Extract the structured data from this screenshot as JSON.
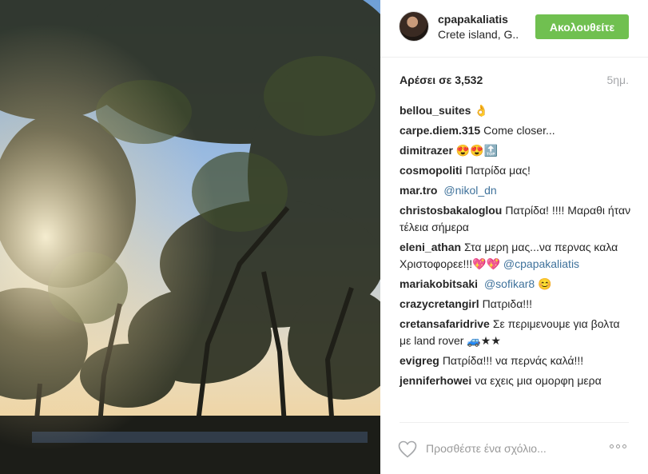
{
  "post": {
    "username": "cpapakaliatis",
    "location": "Crete island, G..",
    "follow_label": "Ακολουθείτε",
    "likes_text": "Αρέσει σε 3,532",
    "time_ago": "5ημ.",
    "comment_placeholder": "Προσθέστε ένα σχόλιο...",
    "colors": {
      "follow_button": "#70c050",
      "mention": "#3f729b"
    },
    "comments": [
      {
        "author": "bellou_suites",
        "text": "👌",
        "mention": ""
      },
      {
        "author": "carpe.diem.315",
        "text": "Come closer...",
        "mention": ""
      },
      {
        "author": "dimitrazer",
        "text": "😍😍🔝",
        "mention": ""
      },
      {
        "author": "cosmopoliti",
        "text": "Πατρίδα μας!",
        "mention": ""
      },
      {
        "author": "mar.tro",
        "text": "",
        "mention": "@nikol_dn"
      },
      {
        "author": "christosbakaloglou",
        "text": "Πατρίδα! !!!! Μαραθι ήταν τέλεια σήμερα",
        "mention": ""
      },
      {
        "author": "eleni_athan",
        "text": "Στα μερη μας...να περνας καλα Χριστοφορεε!!!💖💖",
        "mention": "@cpapakaliatis"
      },
      {
        "author": "mariakobitsaki",
        "text": "",
        "mention": "@sofikar8 😊"
      },
      {
        "author": "crazycretangirl",
        "text": "Πατριδα!!!",
        "mention": ""
      },
      {
        "author": "cretansafaridrive",
        "text": "Σε περιμενουμε για βολτα με land rover 🚙★★",
        "mention": ""
      },
      {
        "author": "evigreg",
        "text": "Πατρίδα!!! να περνάς καλά!!!",
        "mention": ""
      },
      {
        "author": "jenniferhowei",
        "text": "να εχεις μια ομορφη μερα",
        "mention": ""
      }
    ]
  }
}
